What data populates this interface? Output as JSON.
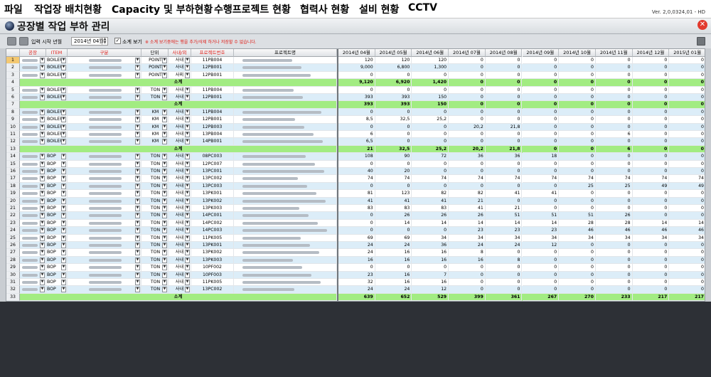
{
  "menu": [
    "파일",
    "작업장 배치현황",
    "Capacity 및 부하현황",
    "수행프로젝트 현황",
    "협력사 현황",
    "설비 현황",
    "CCTV"
  ],
  "version": "Ver. 2,0,0324,01 - HD",
  "window": {
    "title": "공장별 작업 부하 관리",
    "close_label": "✕"
  },
  "filter": {
    "start_label": "입력 시작 년월",
    "start_value": "2014년 04월",
    "subtotal_checked": "✓",
    "subtotal_label": "소계 보기",
    "notice": "※ 소계 보기중에는 행을 추가/삭제 하거나 저장할 수 없습니다."
  },
  "columns": {
    "factory": "공장",
    "item": "ITEM",
    "category": "구분",
    "unit": "단위",
    "inout": "사내/외",
    "project_no": "프로젝트번호",
    "project_name": "프로젝트명",
    "months": [
      "2014년 04월",
      "2014년 05월",
      "2014년 06월",
      "2014년 07월",
      "2014년 08월",
      "2014년 09월",
      "2014년 10월",
      "2014년 11월",
      "2014년 12월",
      "2015년 01월"
    ]
  },
  "subtotal_text": "소계",
  "dropdown_glyph": "▼",
  "rows": [
    {
      "n": "1",
      "item": "BOILER",
      "unit": "POINT",
      "io": "사내",
      "pno": "11PB004",
      "v": [
        "120",
        "120",
        "120",
        "0",
        "0",
        "0",
        "0",
        "0",
        "0",
        "0"
      ]
    },
    {
      "n": "2",
      "item": "BOILER",
      "unit": "POINT",
      "io": "사내",
      "pno": "12PB001",
      "v": [
        "9,000",
        "6,800",
        "1,300",
        "0",
        "0",
        "0",
        "0",
        "0",
        "0",
        "0"
      ]
    },
    {
      "n": "3",
      "item": "BOILER",
      "unit": "POINT",
      "io": "사외",
      "pno": "12PB001",
      "v": [
        "0",
        "0",
        "0",
        "0",
        "0",
        "0",
        "0",
        "0",
        "0",
        "0"
      ]
    },
    {
      "n": "4",
      "sub": true,
      "v": [
        "9,120",
        "6,920",
        "1,420",
        "0",
        "0",
        "0",
        "0",
        "0",
        "0",
        "0"
      ]
    },
    {
      "n": "5",
      "item": "BOILER",
      "unit": "TON",
      "io": "사내",
      "pno": "11PB004",
      "v": [
        "0",
        "0",
        "0",
        "0",
        "0",
        "0",
        "0",
        "0",
        "0",
        "0"
      ]
    },
    {
      "n": "6",
      "item": "BOILER",
      "unit": "TON",
      "io": "사내",
      "pno": "12PB001",
      "v": [
        "393",
        "393",
        "150",
        "0",
        "0",
        "0",
        "0",
        "0",
        "0",
        "0"
      ]
    },
    {
      "n": "7",
      "sub": true,
      "v": [
        "393",
        "393",
        "150",
        "0",
        "0",
        "0",
        "0",
        "0",
        "0",
        "0"
      ]
    },
    {
      "n": "8",
      "item": "BOILER",
      "unit": "KM",
      "io": "사내",
      "pno": "11PB004",
      "v": [
        "0",
        "0",
        "0",
        "0",
        "0",
        "0",
        "0",
        "0",
        "0",
        "0"
      ]
    },
    {
      "n": "9",
      "item": "BOILER",
      "unit": "KM",
      "io": "사내",
      "pno": "12PB001",
      "v": [
        "8,5",
        "32,5",
        "25,2",
        "0",
        "0",
        "0",
        "0",
        "0",
        "0",
        "0"
      ]
    },
    {
      "n": "10",
      "item": "BOILER",
      "unit": "KM",
      "io": "사내",
      "pno": "12PB003",
      "v": [
        "0",
        "0",
        "0",
        "20,2",
        "21,8",
        "0",
        "0",
        "0",
        "0",
        "0"
      ]
    },
    {
      "n": "11",
      "item": "BOILER",
      "unit": "KM",
      "io": "사내",
      "pno": "13PB004",
      "v": [
        "6",
        "0",
        "0",
        "0",
        "0",
        "0",
        "0",
        "6",
        "0",
        "0"
      ]
    },
    {
      "n": "12",
      "item": "BOILER",
      "unit": "KM",
      "io": "사내",
      "pno": "14PB001",
      "v": [
        "6,5",
        "0",
        "0",
        "0",
        "0",
        "0",
        "0",
        "0",
        "0",
        "0"
      ]
    },
    {
      "n": "13",
      "sub": true,
      "v": [
        "21",
        "32,5",
        "25,2",
        "20,2",
        "21,8",
        "0",
        "0",
        "6",
        "0",
        "0"
      ]
    },
    {
      "n": "14",
      "item": "BOP",
      "unit": "TON",
      "io": "사내",
      "pno": "08PC003",
      "v": [
        "108",
        "90",
        "72",
        "36",
        "36",
        "18",
        "0",
        "0",
        "0",
        "0"
      ]
    },
    {
      "n": "15",
      "item": "BOP",
      "unit": "TON",
      "io": "사내",
      "pno": "12PC007",
      "v": [
        "0",
        "0",
        "0",
        "0",
        "0",
        "0",
        "0",
        "0",
        "0",
        "0"
      ]
    },
    {
      "n": "16",
      "item": "BOP",
      "unit": "TON",
      "io": "사내",
      "pno": "13PC001",
      "v": [
        "40",
        "20",
        "0",
        "0",
        "0",
        "0",
        "0",
        "0",
        "0",
        "0"
      ]
    },
    {
      "n": "17",
      "item": "BOP",
      "unit": "TON",
      "io": "사내",
      "pno": "13PC002",
      "v": [
        "74",
        "74",
        "74",
        "74",
        "74",
        "74",
        "74",
        "74",
        "74",
        "74"
      ]
    },
    {
      "n": "18",
      "item": "BOP",
      "unit": "TON",
      "io": "사내",
      "pno": "13PC003",
      "v": [
        "0",
        "0",
        "0",
        "0",
        "0",
        "0",
        "25",
        "25",
        "49",
        "49"
      ]
    },
    {
      "n": "19",
      "item": "BOP",
      "unit": "TON",
      "io": "사내",
      "pno": "13PK001",
      "v": [
        "81",
        "123",
        "82",
        "82",
        "41",
        "41",
        "0",
        "0",
        "0",
        "0"
      ]
    },
    {
      "n": "20",
      "item": "BOP",
      "unit": "TON",
      "io": "사내",
      "pno": "13PK002",
      "v": [
        "41",
        "41",
        "41",
        "21",
        "0",
        "0",
        "0",
        "0",
        "0",
        "0"
      ]
    },
    {
      "n": "21",
      "item": "BOP",
      "unit": "TON",
      "io": "사내",
      "pno": "13PK003",
      "v": [
        "83",
        "83",
        "83",
        "41",
        "21",
        "0",
        "0",
        "0",
        "0",
        "0"
      ]
    },
    {
      "n": "22",
      "item": "BOP",
      "unit": "TON",
      "io": "사내",
      "pno": "14PC001",
      "v": [
        "0",
        "26",
        "26",
        "26",
        "51",
        "51",
        "51",
        "26",
        "0",
        "0"
      ]
    },
    {
      "n": "23",
      "item": "BOP",
      "unit": "TON",
      "io": "사내",
      "pno": "14PC002",
      "v": [
        "0",
        "14",
        "14",
        "14",
        "14",
        "14",
        "28",
        "28",
        "14",
        "14"
      ]
    },
    {
      "n": "24",
      "item": "BOP",
      "unit": "TON",
      "io": "사내",
      "pno": "14PC003",
      "v": [
        "0",
        "0",
        "0",
        "23",
        "23",
        "23",
        "46",
        "46",
        "46",
        "46"
      ]
    },
    {
      "n": "25",
      "item": "BOP",
      "unit": "TON",
      "io": "사내",
      "pno": "11PK005",
      "v": [
        "69",
        "69",
        "34",
        "34",
        "34",
        "34",
        "34",
        "34",
        "34",
        "34"
      ]
    },
    {
      "n": "26",
      "item": "BOP",
      "unit": "TON",
      "io": "사내",
      "pno": "13PK001",
      "v": [
        "24",
        "24",
        "36",
        "24",
        "24",
        "12",
        "0",
        "0",
        "0",
        "0"
      ]
    },
    {
      "n": "27",
      "item": "BOP",
      "unit": "TON",
      "io": "사내",
      "pno": "13PK002",
      "v": [
        "24",
        "16",
        "16",
        "8",
        "0",
        "0",
        "0",
        "0",
        "0",
        "0"
      ]
    },
    {
      "n": "28",
      "item": "BOP",
      "unit": "TON",
      "io": "사내",
      "pno": "13PK003",
      "v": [
        "16",
        "16",
        "16",
        "16",
        "8",
        "0",
        "0",
        "0",
        "0",
        "0"
      ]
    },
    {
      "n": "29",
      "item": "BOP",
      "unit": "TON",
      "io": "사내",
      "pno": "10PF002",
      "v": [
        "0",
        "0",
        "0",
        "0",
        "0",
        "0",
        "0",
        "0",
        "0",
        "0"
      ]
    },
    {
      "n": "30",
      "item": "BOP",
      "unit": "TON",
      "io": "사내",
      "pno": "10PF003",
      "v": [
        "23",
        "16",
        "7",
        "0",
        "0",
        "0",
        "0",
        "0",
        "0",
        "0"
      ]
    },
    {
      "n": "31",
      "item": "BOP",
      "unit": "TON",
      "io": "사내",
      "pno": "11PK005",
      "v": [
        "32",
        "16",
        "16",
        "0",
        "0",
        "0",
        "0",
        "0",
        "0",
        "0"
      ]
    },
    {
      "n": "32",
      "item": "BOP",
      "unit": "TON",
      "io": "사내",
      "pno": "13PC002",
      "v": [
        "24",
        "24",
        "12",
        "0",
        "0",
        "0",
        "0",
        "0",
        "0",
        "0"
      ]
    },
    {
      "n": "33",
      "sub": true,
      "v": [
        "639",
        "652",
        "529",
        "399",
        "361",
        "267",
        "270",
        "233",
        "217",
        "217"
      ]
    }
  ]
}
